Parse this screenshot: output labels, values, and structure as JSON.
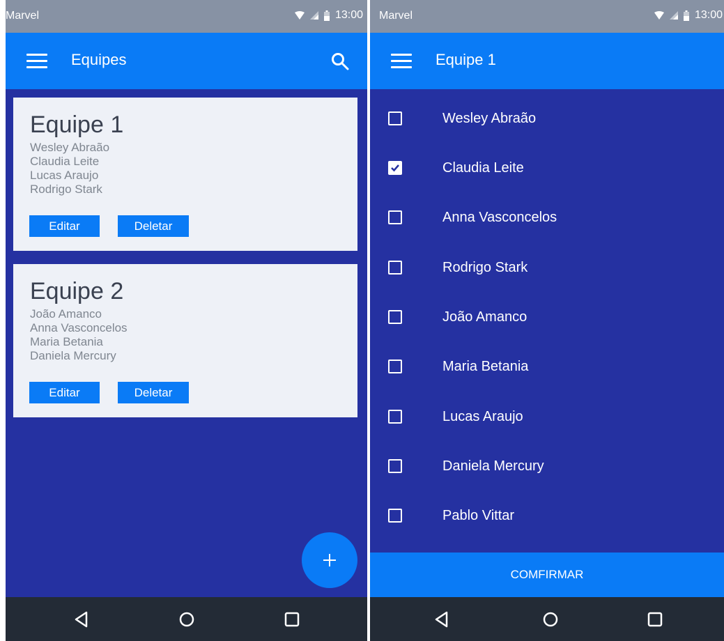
{
  "colors": {
    "statusbar": "#8792a4",
    "appbar": "#0a7bf6",
    "background": "#2531a1",
    "card": "#eef1f7",
    "navbar": "#232b36"
  },
  "left": {
    "status": {
      "carrier": "Marvel",
      "time": "13:00"
    },
    "appbar": {
      "title": "Equipes",
      "icons": [
        "menu-icon",
        "search-icon"
      ]
    },
    "teams": [
      {
        "name": "Equipe 1",
        "members": [
          "Wesley Abraão",
          "Claudia Leite",
          "Lucas Araujo",
          "Rodrigo Stark"
        ],
        "edit_label": "Editar",
        "delete_label": "Deletar"
      },
      {
        "name": "Equipe 2",
        "members": [
          "João Amanco",
          "Anna Vasconcelos",
          "Maria Betania",
          "Daniela Mercury"
        ],
        "edit_label": "Editar",
        "delete_label": "Deletar"
      }
    ],
    "fab_icon": "plus-icon",
    "nav_icons": [
      "back-icon",
      "home-icon",
      "recents-icon"
    ]
  },
  "right": {
    "status": {
      "carrier": "Marvel",
      "time": "13:00"
    },
    "appbar": {
      "title": "Equipe 1",
      "icons": [
        "menu-icon"
      ]
    },
    "members": [
      {
        "name": "Wesley Abraão",
        "checked": false
      },
      {
        "name": "Claudia Leite",
        "checked": true
      },
      {
        "name": "Anna Vasconcelos",
        "checked": false
      },
      {
        "name": "Rodrigo Stark",
        "checked": false
      },
      {
        "name": "João Amanco",
        "checked": false
      },
      {
        "name": "Maria Betania",
        "checked": false
      },
      {
        "name": "Lucas Araujo",
        "checked": false
      },
      {
        "name": "Daniela Mercury",
        "checked": false
      },
      {
        "name": "Pablo Vittar",
        "checked": false
      }
    ],
    "confirm_label": "COMFIRMAR",
    "nav_icons": [
      "back-icon",
      "home-icon",
      "recents-icon"
    ]
  }
}
